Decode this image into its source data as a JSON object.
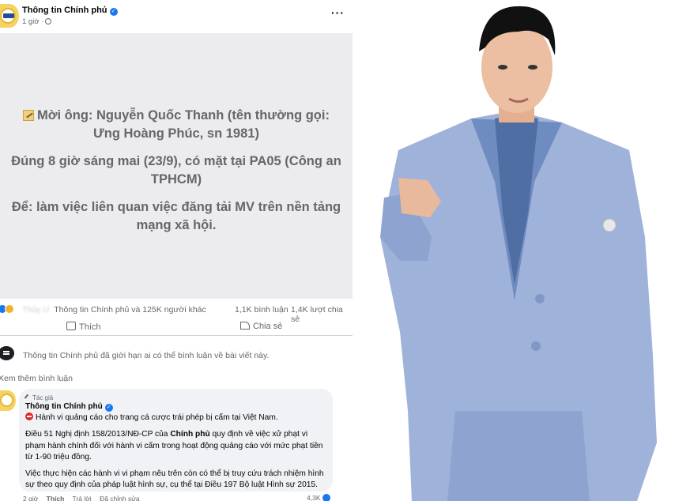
{
  "post": {
    "page_name": "Thông tin Chính phủ",
    "time": "1 giờ ·",
    "text_lines": [
      "Mời ông: Nguyễn Quốc Thanh (tên thường gọi: Ưng Hoàng Phúc, sn 1981)",
      "Đúng 8 giờ sáng mai (23/9), có mặt tại PA05 (Công an TPHCM)",
      "Để: làm việc liên quan việc đăng tải MV trên nền tảng mạng xã hội."
    ],
    "text_line1_a": "Mời ông: Nguyễn Quốc Thanh (tên thường gọi:",
    "text_line1_b": "Ưng Hoàng Phúc, sn 1981)",
    "text_line2_a": "Đúng 8 giờ sáng mai (23/9), có mặt tại PA05 (Công an",
    "text_line2_b": "TPHCM)",
    "text_line3_a": "Để: làm việc liên quan việc đăng tải MV trên nền tảng",
    "text_line3_b": "mạng xã hội."
  },
  "reactions": {
    "blurred_name": "Thủy Ư",
    "names": "Thông tin Chính phủ và 125K người khác",
    "comments": "1,1K bình luận",
    "shares": "1,4K lượt chia sẻ"
  },
  "actions": {
    "like": "Thích",
    "share": "Chia sẻ"
  },
  "limit_notice": "Thông tin Chính phủ đã giới hạn ai có thể bình luận về bài viết này.",
  "see_more_comments": "Xem thêm bình luận",
  "comment": {
    "badge": "Tác giả",
    "author": "Thông tin Chính phủ",
    "line1": "Hành vi quảng cáo cho trang cá cược trái phép bị cấm tại Việt Nam.",
    "para2_a": "Điều 51 Nghị định 158/2013/NĐ-CP của ",
    "para2_bold": "Chính phủ",
    "para2_b": " quy định về việc xử phạt vi phạm hành chính đối với hành vi cấm trong hoạt động quảng cáo với mức phạt tiền từ 1-90 triệu đồng.",
    "para3": "Việc thực hiện các hành vi vi phạm nêu trên còn có thể bị truy cứu trách nhiệm hình sự theo quy định của pháp luật hình sự, cụ thể tại Điều 197 Bộ luật Hình sự 2015.",
    "time": "2 giờ",
    "like": "Thích",
    "reply": "Trả lời",
    "edited": "Đã chỉnh sửa",
    "react_count": "4,3K"
  },
  "colors": {
    "fb_blue": "#1877f2",
    "post_bg": "#ecebed",
    "suit": "#9fb2d9"
  }
}
